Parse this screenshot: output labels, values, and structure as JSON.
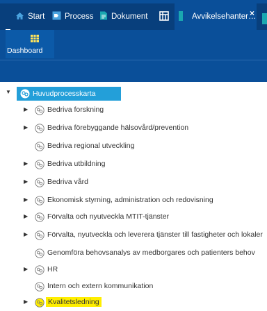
{
  "tabs": [
    {
      "label": "Start",
      "icon": "home-icon"
    },
    {
      "label": "Process",
      "icon": "process-icon"
    },
    {
      "label": "Dokument",
      "icon": "document-icon"
    },
    {
      "label": "",
      "icon": "grid-icon"
    },
    {
      "label": "Avvikelsehanter…",
      "icon": "deviation-icon"
    }
  ],
  "ribbon": {
    "dashboard_label": "Dashboard",
    "icon": "dashboard-icon"
  },
  "tree": {
    "root_label": "Huvudprocesskarta",
    "items": [
      {
        "label": "Bedriva forskning",
        "expandable": true
      },
      {
        "label": "Bedriva förebyggande hälsovård/prevention",
        "expandable": true
      },
      {
        "label": "Bedriva regional utveckling",
        "expandable": false
      },
      {
        "label": "Bedriva utbildning",
        "expandable": true
      },
      {
        "label": "Bedriva vård",
        "expandable": true
      },
      {
        "label": "Ekonomisk styrning, administration och redovisning",
        "expandable": true
      },
      {
        "label": "Förvalta och nyutveckla MTIT-tjänster",
        "expandable": true
      },
      {
        "label": "Förvalta, nyutveckla och leverera tjänster till fastigheter och lokaler",
        "expandable": true
      },
      {
        "label": "Genomföra behovsanalys av medborgares och patienters behov",
        "expandable": false
      },
      {
        "label": "HR",
        "expandable": true
      },
      {
        "label": "Intern och extern kommunikation",
        "expandable": false
      },
      {
        "label": "Kvalitetsledning",
        "expandable": true,
        "highlighted": true
      }
    ]
  },
  "colors": {
    "header": "#0a4f99",
    "root_highlight": "#239fd9",
    "search_highlight": "#ffee00"
  }
}
